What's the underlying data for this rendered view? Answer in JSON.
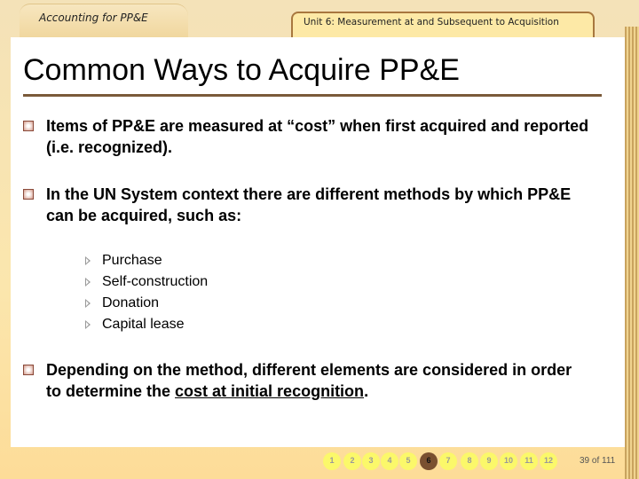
{
  "header": {
    "course_tab": "Accounting for PP&E",
    "unit_tab": "Unit 6: Measurement at and Subsequent to Acquisition"
  },
  "slide": {
    "title": "Common Ways to Acquire PP&E",
    "bullets": [
      {
        "text": "Items of PP&E are measured at “cost” when first acquired and reported (i.e. recognized)."
      },
      {
        "text": "In the UN System context there are different methods by which PP&E can be acquired, such as:"
      },
      {
        "text_before": "Depending on the method, different elements are considered in order to determine the ",
        "link": "cost at initial recognition",
        "text_after": "."
      }
    ],
    "sub_items": [
      "Purchase",
      "Self-construction",
      "Donation",
      "Capital lease"
    ]
  },
  "navigation": {
    "pages": [
      "1",
      "2",
      "3",
      "4",
      "5",
      "6",
      "7",
      "8",
      "9",
      "10",
      "11",
      "12"
    ],
    "current_page": "6",
    "slide_counter": "39 of 111"
  },
  "colors": {
    "accent": "#7a5a3a",
    "nav_dot": "#fbf86a",
    "nav_current": "#7a5030"
  }
}
